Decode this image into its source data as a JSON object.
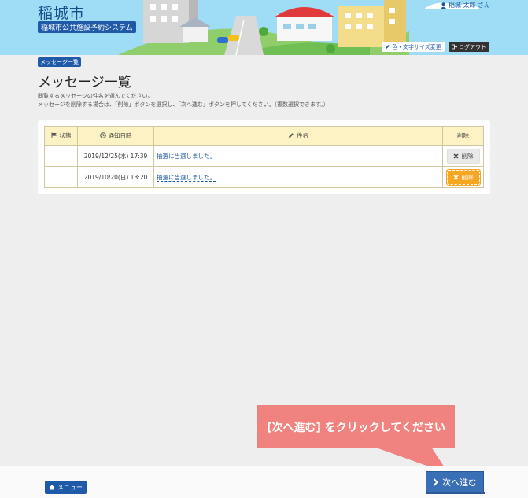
{
  "header": {
    "city_name": "稲城市",
    "system_name": "稲城市公共施設予約システム",
    "user_name": "稲城 太郎 さん",
    "prefs_label": "色・文字サイズ変更",
    "logout_label": "ログアウト"
  },
  "page": {
    "breadcrumb": "メッセージ一覧",
    "title": "メッセージ一覧",
    "desc_line1": "閲覧するメッセージの件名を選んでください。",
    "desc_line2": "メッセージを削除する場合は、「削除」ボタンを選択し、「次へ進む」ボタンを押してください。（複数選択できます。）"
  },
  "table": {
    "columns": [
      "状態",
      "通知日時",
      "件名",
      "削除"
    ],
    "rows": [
      {
        "status": "",
        "date": "2019/12/25(水) 17:39",
        "subject": "抽選に当選しました。",
        "delete_label": "削除"
      },
      {
        "status": "",
        "date": "2019/10/20(日) 13:20",
        "subject": "抽選に当選しました。",
        "delete_label": "削除"
      }
    ]
  },
  "tooltip": {
    "text": "[次へ進む] をクリックしてください"
  },
  "footer": {
    "menu_label": "メニュー",
    "next_label": "次へ進む"
  },
  "icons": {
    "user": "user-icon",
    "prefs": "pencil-icon",
    "logout": "logout-icon",
    "flag": "flag-icon",
    "clock": "clock-icon",
    "pencil": "pencil-icon",
    "close": "close-icon",
    "home": "home-icon",
    "chevron": "chevron-right-icon"
  },
  "colors": {
    "brand": "#1e5aa8",
    "header_bg": "#9fdcf5",
    "table_header": "#fcf2c4",
    "highlight": "#f5a623",
    "tooltip": "#f0837f",
    "next_button": "#3a6fb5"
  }
}
